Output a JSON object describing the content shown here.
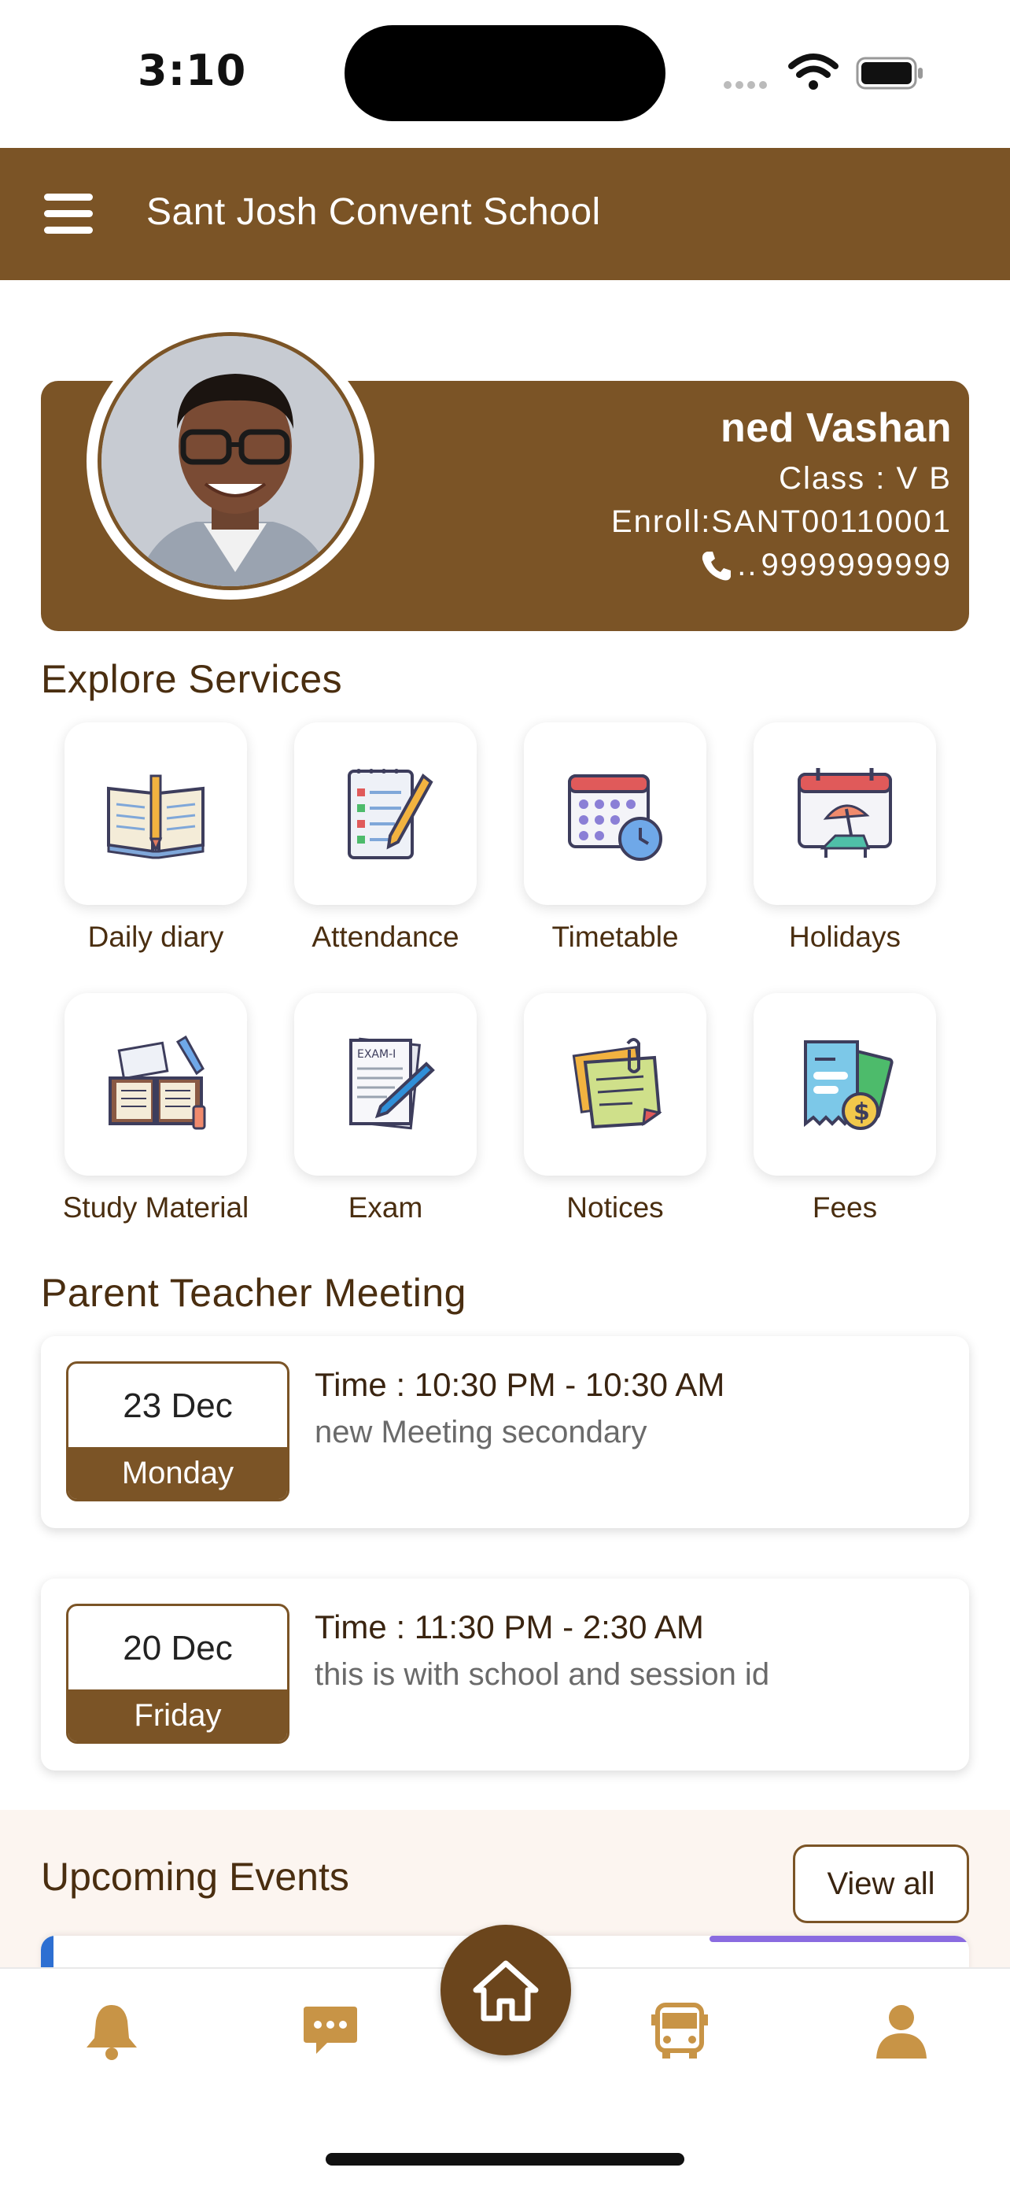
{
  "status_bar": {
    "time": "3:10"
  },
  "header": {
    "title": "Sant Josh Convent School",
    "menu_icon": "hamburger-menu-icon"
  },
  "profile": {
    "name": "ned Vashan",
    "class_line": "Class : V B",
    "enroll_line": "Enroll:SANT00110001",
    "phone_prefix": "..",
    "phone": "9999999999"
  },
  "services": {
    "title": "Explore Services",
    "items": [
      {
        "label": "Daily diary",
        "icon": "open-book-icon"
      },
      {
        "label": "Attendance",
        "icon": "checklist-pencil-icon"
      },
      {
        "label": "Timetable",
        "icon": "calendar-clock-icon"
      },
      {
        "label": "Holidays",
        "icon": "calendar-beach-umbrella-icon"
      },
      {
        "label": "Study Material",
        "icon": "study-books-icon"
      },
      {
        "label": "Exam",
        "icon": "exam-paper-pen-icon"
      },
      {
        "label": "Notices",
        "icon": "sticky-notes-icon"
      },
      {
        "label": "Fees",
        "icon": "receipt-money-icon"
      }
    ]
  },
  "ptm": {
    "title": "Parent Teacher Meeting",
    "meetings": [
      {
        "date": "23 Dec",
        "weekday": "Monday",
        "time": "Time :  10:30 PM  - 10:30 AM",
        "description": "new Meeting secondary"
      },
      {
        "date": "20 Dec",
        "weekday": "Friday",
        "time": "Time :  11:30 PM  - 2:30 AM",
        "description": "this is with school and session id"
      }
    ]
  },
  "events": {
    "title": "Upcoming Events",
    "view_all": "View all"
  },
  "bottom_nav": {
    "items": [
      "bell-icon",
      "chat-icon",
      "home-icon",
      "bus-icon",
      "user-icon"
    ],
    "accent": "#c89446",
    "home_bg": "#6b451c"
  },
  "colors": {
    "brand": "#7b5426",
    "text": "#4a2e10"
  }
}
